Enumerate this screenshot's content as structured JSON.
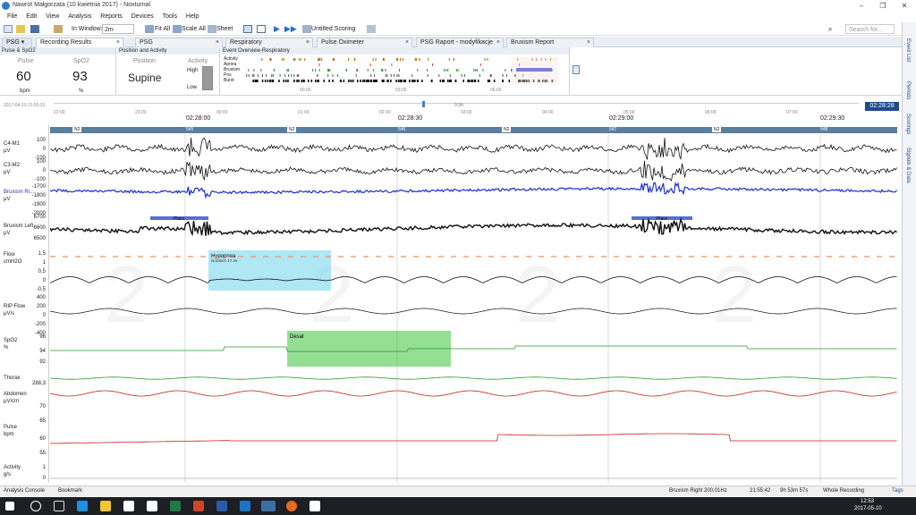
{
  "window": {
    "title": "Nawrot Małgorzata (10 kwietnia 2017) - Noxturnal",
    "controls": [
      "–",
      "❐",
      "✕"
    ]
  },
  "menu": [
    "File",
    "Edit",
    "View",
    "Analysis",
    "Reports",
    "Devices",
    "Tools",
    "Help"
  ],
  "toolbar": {
    "in_window_label": "In Window:",
    "in_window_value": "2m",
    "fit_all": "Fit All",
    "scale_all": "Scale All",
    "sheet": "Sheet",
    "scoring": "Untitled Scoring",
    "search_placeholder": "Search for..."
  },
  "tabs": [
    {
      "label": "PSG",
      "active": false
    },
    {
      "label": "Recording Results",
      "active": true
    },
    {
      "label": "PSG",
      "active": false
    },
    {
      "label": "Respiratory",
      "active": false
    },
    {
      "label": "Pulse Oximeter",
      "active": false
    },
    {
      "label": "PSG Raport - modyfikacje",
      "active": false
    },
    {
      "label": "Bruxism Report",
      "active": false
    }
  ],
  "pulse_panel": {
    "title": "Pulse & SpO2",
    "pulse_label": "Pulse",
    "pulse_value": "60",
    "pulse_unit": "bpm",
    "spo2_label": "SpO2",
    "spo2_value": "93",
    "spo2_unit": "%"
  },
  "position_panel": {
    "title": "Position and Activity",
    "position_label": "Position",
    "position_value": "Supine",
    "activity_label": "Activity",
    "high": "High",
    "low": "Low"
  },
  "overview_panel": {
    "title": "Event Overview-Respiratory",
    "rows": [
      "Activity",
      "Apnea",
      "Bruxism",
      "Pos",
      "Burst"
    ],
    "times": [
      "00:00",
      "03:00",
      "06:00"
    ]
  },
  "timeline": {
    "date": "2017-04-10 21:55:31",
    "hours": [
      "22:00",
      "23:00",
      "00:00",
      "01:00",
      "02:00",
      "03:00",
      "04:00",
      "05:00",
      "06:00",
      "07:00"
    ],
    "current": "02:28:28",
    "marker": "9.9h",
    "clock_ticks": [
      "02:28:00",
      "02:28:30",
      "02:29:00",
      "02:29:30"
    ],
    "stages": [
      "N2",
      "N2",
      "N2",
      "N2",
      "N2",
      "N2"
    ],
    "epochs": [
      "545",
      "546",
      "547",
      "548"
    ]
  },
  "channels": [
    {
      "name": "C4-M1",
      "unit": "µV",
      "scale": [
        "100",
        "0",
        "-100"
      ]
    },
    {
      "name": "C3-M2",
      "unit": "µV",
      "scale": [
        "100",
        "0",
        "-100"
      ]
    },
    {
      "name": "Bruxism Ri...",
      "unit": "µV",
      "scale": [
        "-1700",
        "-1800",
        "-1900",
        "-2000"
      ]
    },
    {
      "name": "Bruxism Left",
      "unit": "µV",
      "scale": [
        "6700",
        "6600",
        "6500"
      ]
    },
    {
      "name": "Flow",
      "unit": "cmH2O",
      "scale": [
        "1,5",
        "1",
        "0,5",
        "0",
        "-0,5"
      ]
    },
    {
      "name": "RIP Flow",
      "unit": "µV/s",
      "scale": [
        "400",
        "200",
        "0",
        "-200",
        "-400"
      ]
    },
    {
      "name": "SpO2",
      "unit": "%",
      "scale": [
        "96",
        "94",
        "92"
      ]
    },
    {
      "name": "Thorax",
      "unit": "",
      "scale": [
        "288,3"
      ]
    },
    {
      "name": "Abdomen",
      "unit": "µV/cm",
      "scale": []
    },
    {
      "name": "Pulse",
      "unit": "bpm",
      "scale": [
        "70",
        "65",
        "60",
        "55"
      ]
    },
    {
      "name": "Activity",
      "unit": "g/s",
      "scale": [
        "1",
        "0"
      ]
    }
  ],
  "events": {
    "hypopnea": {
      "label": "Hypopnea",
      "duration": "Duration 17.4s"
    },
    "desat": {
      "label": "Desat"
    },
    "plasc": "Plasc"
  },
  "right_tabs": [
    "Event List",
    "Periods",
    "Scorings",
    "Signals & Data"
  ],
  "status": {
    "analysis_console": "Analysis Console",
    "bookmark": "Bookmark",
    "signal": "Bruxism Right 200,01Hz",
    "time": "21:55:42",
    "duration": "9h 53m 57s",
    "view": "Whole Recording",
    "tags": "Tags"
  },
  "taskbar": {
    "time": "12:53",
    "date": "2017-05-10"
  }
}
